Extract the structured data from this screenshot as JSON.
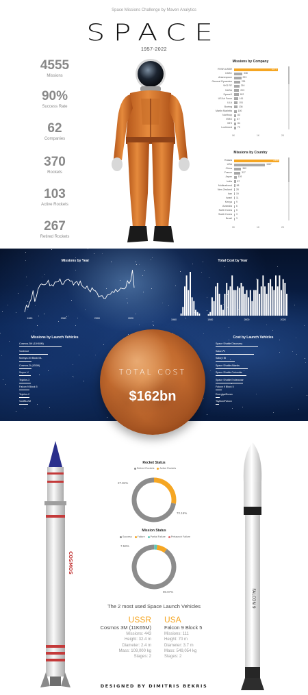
{
  "header": {
    "subtitle": "Space Missions Challenge by Maven Analytics",
    "title": "SPACE",
    "years": "1957-2022"
  },
  "kpis": [
    {
      "value": "4555",
      "label": "Missions"
    },
    {
      "value": "90%",
      "label": "Success Rate"
    },
    {
      "value": "62",
      "label": "Companies"
    },
    {
      "value": "370",
      "label": "Rockets"
    },
    {
      "value": "103",
      "label": "Active Rockets"
    },
    {
      "value": "267",
      "label": "Retired Rockets"
    }
  ],
  "colors": {
    "accent": "#f5a623",
    "bar": "#a8a8a8",
    "donut_base": "#8c8c8c"
  },
  "chart_data": [
    {
      "id": "missions_by_company",
      "type": "bar",
      "orientation": "horizontal",
      "title": "Missions by Company",
      "categories": [
        "RVSN USSR",
        "CASC",
        "Arianespace",
        "General Dynamics",
        "VKS RF",
        "NASA",
        "SpaceX",
        "US Air Force",
        "ULA",
        "Boeing",
        "Martin Marietta",
        "Northrop",
        "ISRO",
        "MHI",
        "Lockheed"
      ],
      "values": [
        1777,
        338,
        293,
        251,
        216,
        203,
        182,
        161,
        151,
        136,
        100,
        83,
        67,
        84,
        79
      ],
      "value_labels": [
        "1777",
        "338",
        "293",
        "251",
        "216",
        "203",
        "182",
        "161",
        "151",
        "136",
        "100",
        "83",
        "67",
        "84",
        "79"
      ],
      "highlight": "RVSN USSR",
      "xticks": [
        "0K",
        "1K",
        "2K"
      ],
      "xlim": [
        0,
        2000
      ]
    },
    {
      "id": "missions_by_country",
      "type": "bar",
      "orientation": "horizontal",
      "title": "Missions by Country",
      "categories": [
        "Russia",
        "USA",
        "China",
        "France",
        "Japan",
        "India",
        "Multinational",
        "New Zealand",
        "Iran",
        "Israel",
        "Kenya",
        "Australia",
        "North Korea",
        "South Korea",
        "Brazil"
      ],
      "values": [
        2306,
        1567,
        360,
        317,
        126,
        87,
        58,
        28,
        19,
        11,
        9,
        6,
        5,
        3,
        3
      ],
      "value_labels": [
        "2306",
        "1567",
        "360",
        "317",
        "126",
        "87",
        "58",
        "28",
        "19",
        "11",
        "9",
        "6",
        "5",
        "3",
        "3"
      ],
      "highlight": "Russia",
      "xticks": [
        "0K",
        "1K",
        "2K"
      ],
      "xlim": [
        0,
        2500
      ]
    },
    {
      "id": "missions_by_year",
      "type": "line",
      "title": "Missions by Year",
      "x": [
        1957,
        1958,
        1959,
        1960,
        1961,
        1962,
        1963,
        1964,
        1965,
        1966,
        1967,
        1968,
        1969,
        1970,
        1971,
        1972,
        1973,
        1974,
        1975,
        1976,
        1977,
        1978,
        1979,
        1980,
        1981,
        1982,
        1983,
        1984,
        1985,
        1986,
        1987,
        1988,
        1989,
        1990,
        1991,
        1992,
        1993,
        1994,
        1995,
        1996,
        1997,
        1998,
        1999,
        2000,
        2001,
        2002,
        2003,
        2004,
        2005,
        2006,
        2007,
        2008,
        2009,
        2010,
        2011,
        2012,
        2013,
        2014,
        2015,
        2016,
        2017,
        2018,
        2019,
        2020,
        2021,
        2022
      ],
      "values": [
        3,
        28,
        20,
        39,
        52,
        82,
        41,
        60,
        87,
        101,
        106,
        103,
        103,
        107,
        119,
        99,
        103,
        98,
        113,
        113,
        114,
        124,
        105,
        105,
        117,
        121,
        123,
        116,
        117,
        102,
        111,
        115,
        101,
        116,
        100,
        93,
        89,
        98,
        85,
        77,
        92,
        83,
        80,
        73,
        58,
        62,
        63,
        53,
        53,
        65,
        67,
        69,
        78,
        74,
        86,
        78,
        82,
        91,
        89,
        88,
        92,
        117,
        107,
        119,
        157,
        92
      ],
      "xticks": [
        "1960",
        "1980",
        "2000",
        "2020"
      ],
      "ylim": [
        0,
        170
      ]
    },
    {
      "id": "total_cost_by_year",
      "type": "bar",
      "title": "Total Cost by Year",
      "x": [
        1964,
        1965,
        1966,
        1967,
        1968,
        1969,
        1970,
        1971,
        1972,
        1973,
        1974,
        1975,
        1976,
        1977,
        1978,
        1979,
        1980,
        1981,
        1982,
        1983,
        1984,
        1985,
        1986,
        1987,
        1988,
        1989,
        1990,
        1991,
        1992,
        1993,
        1994,
        1995,
        1996,
        1997,
        1998,
        1999,
        2000,
        2001,
        2002,
        2003,
        2004,
        2005,
        2006,
        2007,
        2008,
        2009,
        2010,
        2011,
        2012,
        2013,
        2014,
        2015,
        2016,
        2017,
        2018,
        2019,
        2020,
        2021,
        2022
      ],
      "values": [
        0.3,
        1.2,
        4.0,
        5.5,
        3.5,
        6.0,
        2.5,
        2.0,
        0.8,
        0.5,
        0.3,
        0,
        0,
        0,
        0,
        0.2,
        0.5,
        2.5,
        2.0,
        4.0,
        4.5,
        3.0,
        1.5,
        0.8,
        3.0,
        4.5,
        3.5,
        4.0,
        5.5,
        3.5,
        3.5,
        4.0,
        3.8,
        4.5,
        4.0,
        3.0,
        3.5,
        2.5,
        3.5,
        2.0,
        3.5,
        3.5,
        5.0,
        3.0,
        4.0,
        5.5,
        4.0,
        3.0,
        4.5,
        5.0,
        4.0,
        3.5,
        5.5,
        4.0,
        5.5,
        3.5,
        5.0,
        4.5,
        3.0
      ],
      "xticks": [
        "1960",
        "1980",
        "2000",
        "2020"
      ],
      "ylabel": ""
    },
    {
      "id": "missions_by_launch_vehicle",
      "type": "bar",
      "orientation": "horizontal",
      "title": "Missions by Launch Vehicles",
      "categories": [
        "Cosmos-3M (11K65M)",
        "Voskhod",
        "Molniya-M /Block ML",
        "Cosmos-2I (63SM)",
        "Soyuz U",
        "Tsyklon-3",
        "Falcon 9 Block 5",
        "Tsyklon-2",
        "Vostok-2M"
      ],
      "values": [
        446,
        299,
        128,
        126,
        125,
        122,
        111,
        106,
        93
      ]
    },
    {
      "id": "cost_by_launch_vehicle",
      "type": "bar",
      "orientation": "horizontal",
      "title": "Cost by Launch Vehicles",
      "categories": [
        "Space Shuttle Discovery",
        "Saturn V",
        "Saturn IB",
        "Space Shuttle Atlantis",
        "Space Shuttle Columbia",
        "Space Shuttle Endeavour",
        "Falcon 9 Block 5",
        "Energiya/Buran",
        "Tsyklon/Falcon"
      ],
      "values": [
        40,
        36,
        18,
        30,
        29,
        26,
        6,
        4,
        3
      ]
    },
    {
      "id": "rocket_status",
      "type": "pie",
      "title": "Rocket Status",
      "labels": [
        "Retired Rockets",
        "Active Rockets"
      ],
      "values": [
        72.16,
        27.84
      ],
      "value_labels": [
        "72.16%",
        "27.84%"
      ],
      "colors": [
        "#8c8c8c",
        "#f5a623"
      ]
    },
    {
      "id": "mission_status",
      "type": "pie",
      "title": "Mission Status",
      "labels": [
        "Success",
        "Failure",
        "Partial Failure",
        "Prelaunch Failure"
      ],
      "values": [
        90.07,
        7.53,
        2.25,
        0.15
      ],
      "value_labels": [
        "90.07%",
        "7.53%"
      ],
      "colors": [
        "#8c8c8c",
        "#f5a623",
        "#5fc7b7",
        "#e46d6d"
      ]
    }
  ],
  "total_cost": {
    "label": "TOTAL COST",
    "value": "$162bn"
  },
  "vehicles": {
    "title": "The 2 most used Space Launch Vehicles",
    "items": [
      {
        "country": "USSR",
        "name": "Cosmos 3M (11K65M)",
        "specs": [
          "Missions: 443",
          "Height: 32.4 m",
          "Diameter: 2.4 m",
          "Mass: 109,000 kg",
          "Stages: 2"
        ]
      },
      {
        "country": "USA",
        "name": "Falcon 9 Block 5",
        "specs": [
          "Missions: 111",
          "Height: 70 m",
          "Diameter: 3.7 m",
          "Mass: 549,054 kg",
          "Stages: 2"
        ]
      }
    ]
  },
  "footer": "DESIGNED BY DIMITRIS BEKRIS"
}
